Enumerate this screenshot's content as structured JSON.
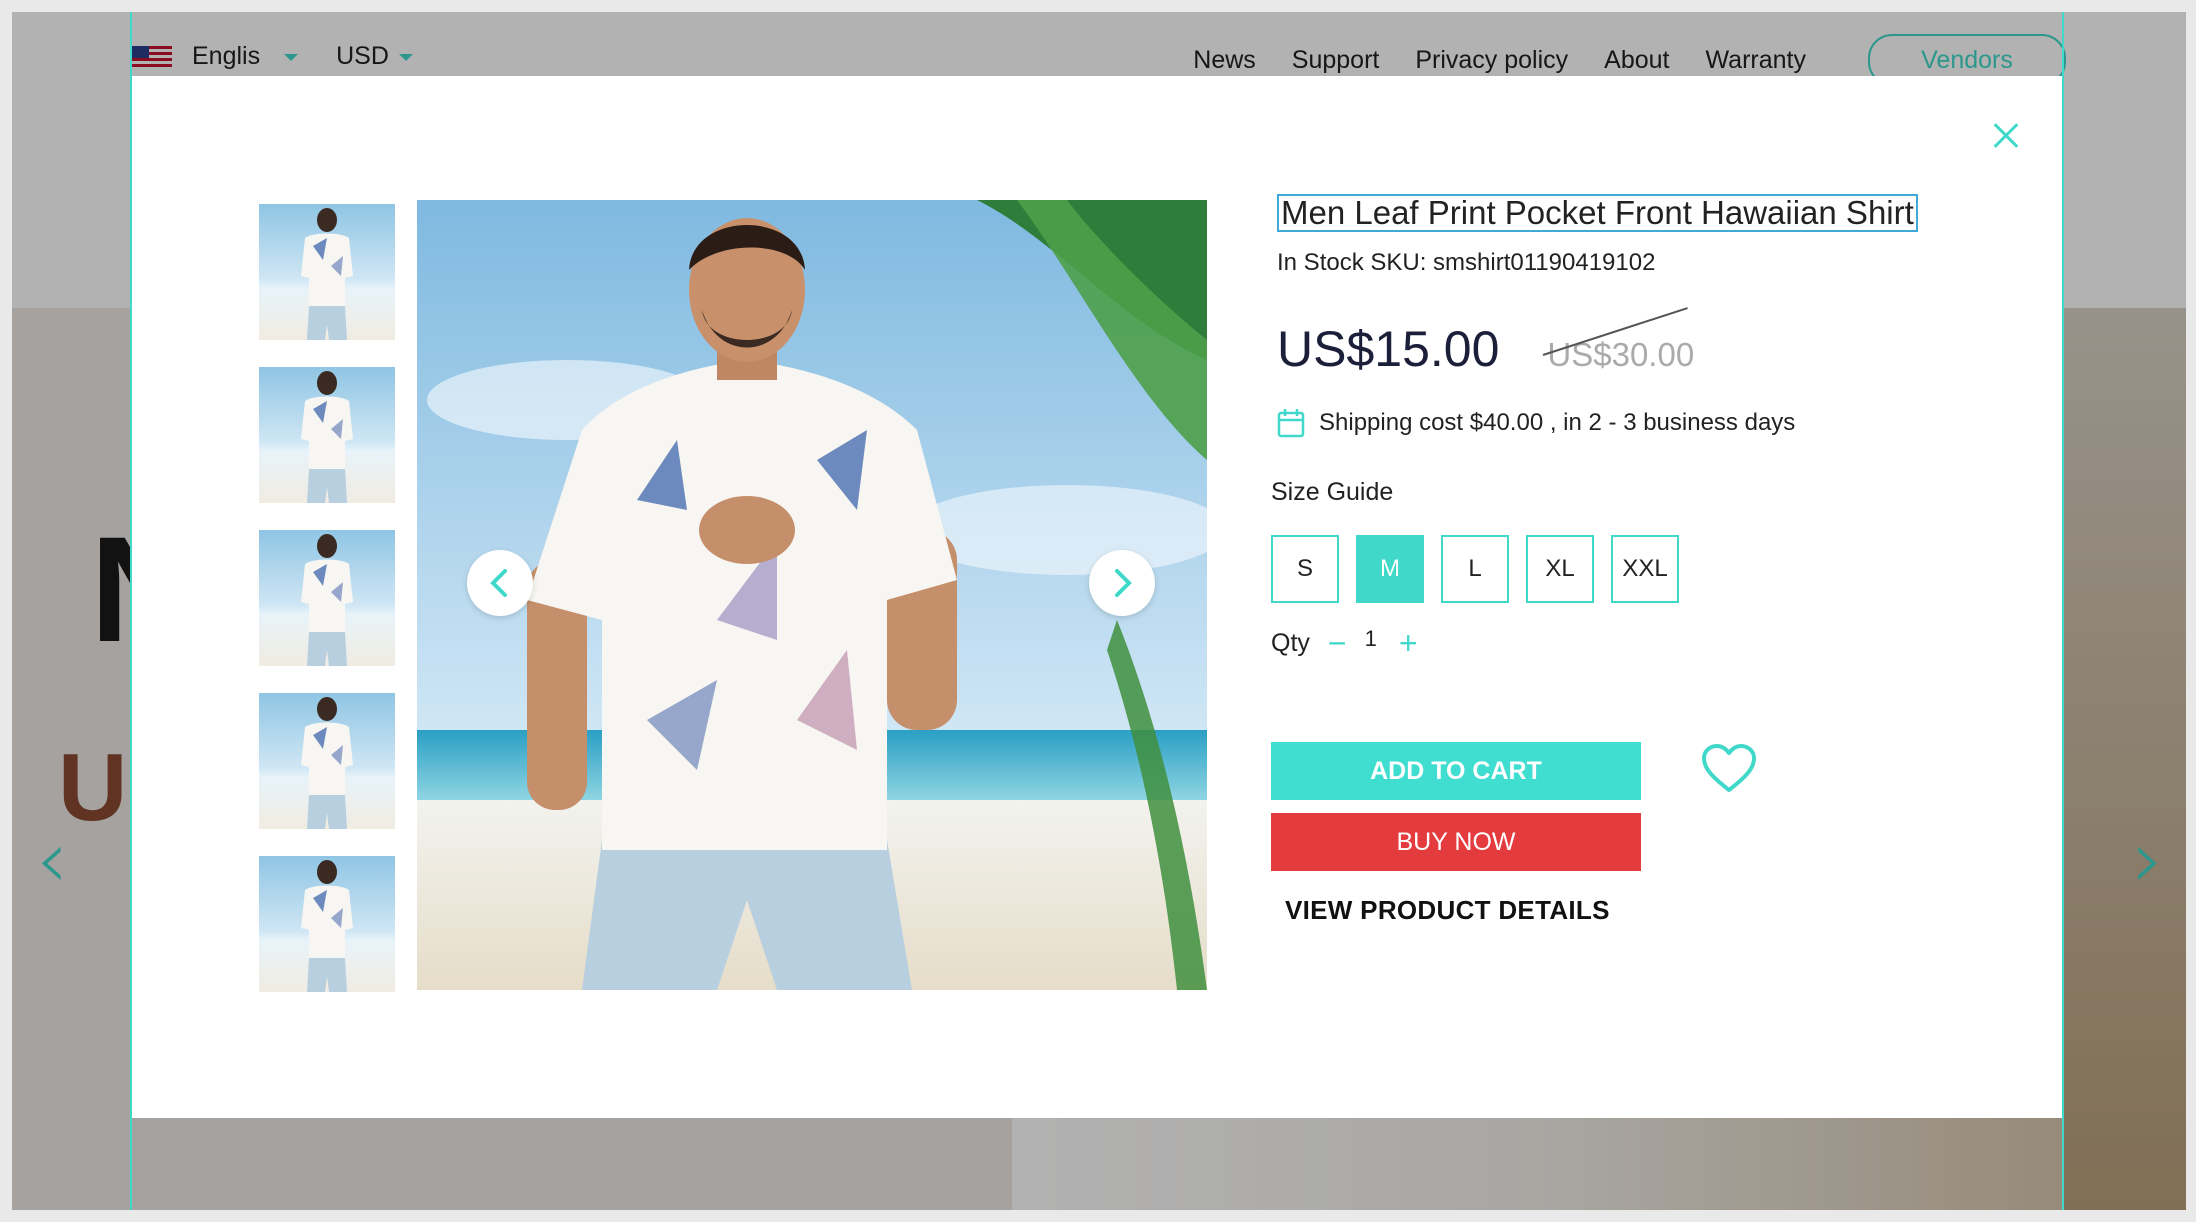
{
  "topbar": {
    "language": "Englis",
    "currency": "USD",
    "links": [
      "News",
      "Support",
      "Privacy policy",
      "About",
      "Warranty"
    ],
    "vendors_label": "Vendors"
  },
  "hero": {
    "text_n": "N",
    "text_u": "U"
  },
  "product": {
    "title": "Men Leaf Print Pocket Front Hawaiian Shirt",
    "stock_sku": "In Stock SKU: smshirt01190419102",
    "price": "US$15.00",
    "old_price": "US$30.00",
    "shipping": "Shipping cost $40.00 , in 2 - 3 business days",
    "size_guide": "Size Guide",
    "sizes": [
      "S",
      "M",
      "L",
      "XL",
      "XXL"
    ],
    "selected_size": "M",
    "qty_label": "Qty",
    "qty_value": "1",
    "add_to_cart": "ADD TO CART",
    "buy_now": "BUY NOW",
    "view_details": "VIEW PRODUCT DETAILS",
    "thumbnail_count": 5
  },
  "icons": {
    "close": "close-icon",
    "prev": "chevron-left-icon",
    "next": "chevron-right-icon",
    "calendar": "calendar-icon",
    "wishlist": "heart-icon",
    "flag": "us-flag-icon"
  },
  "colors": {
    "accent": "#40d9c9",
    "buy_now": "#e43b3f",
    "price": "#1c1f3a"
  }
}
